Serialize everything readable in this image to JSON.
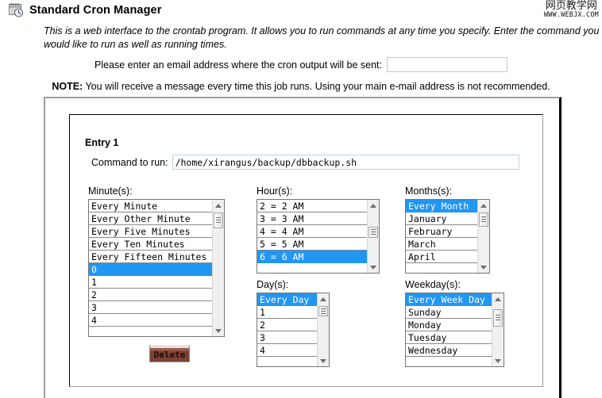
{
  "header": {
    "icon": "calendar-clock-icon",
    "title": "Standard Cron Manager",
    "watermark_cn": "网页教学网",
    "watermark_en": "WWW.WEBJX.COM"
  },
  "intro": {
    "text": "This is a web interface to the crontab program. It allows you to run commands at any time you specify. Enter the command you would like to run as well as running times."
  },
  "email": {
    "label": "Please enter an email address where the cron output will be sent:",
    "value": "",
    "placeholder": ""
  },
  "note": {
    "prefix": "NOTE:",
    "text": " You will receive a message every time this job runs. Using your main e-mail address is not recommended."
  },
  "entry": {
    "title": "Entry 1",
    "command_label": "Command to run:",
    "command_value": "/home/xirangus/backup/dbbackup.sh",
    "delete_label": "Delete"
  },
  "colors": {
    "selection": "#2196f3",
    "selection_text": "#ffffff",
    "delete_button": "#7d4034",
    "panel_border": "#000000",
    "outer_border": "#9e9e9e"
  },
  "fields": {
    "minute": {
      "label": "Minute(s):",
      "options": [
        "Every Minute",
        "Every Other Minute",
        "Every Five Minutes",
        "Every Ten Minutes",
        "Every Fifteen Minutes",
        "0",
        "1",
        "2",
        "3",
        "4"
      ],
      "selected": [
        "0"
      ],
      "scroll_position": "near-top"
    },
    "hour": {
      "label": "Hour(s):",
      "options": [
        "2 = 2 AM",
        "3 = 3 AM",
        "4 = 4 AM",
        "5 = 5 AM",
        "6 = 6 AM"
      ],
      "selected": [
        "6 = 6 AM"
      ],
      "scroll_position": "middle"
    },
    "months": {
      "label": "Months(s):",
      "options": [
        "Every Month",
        "January",
        "February",
        "March",
        "April"
      ],
      "selected": [
        "Every Month"
      ],
      "scroll_position": "top"
    },
    "day": {
      "label": "Day(s):",
      "options": [
        "Every Day",
        "1",
        "2",
        "3",
        "4"
      ],
      "selected": [
        "Every Day"
      ],
      "scroll_position": "top"
    },
    "weekday": {
      "label": "Weekday(s):",
      "options": [
        "Every Week Day",
        "Sunday",
        "Monday",
        "Tuesday",
        "Wednesday"
      ],
      "selected": [
        "Every Week Day"
      ],
      "scroll_position": "top"
    }
  }
}
